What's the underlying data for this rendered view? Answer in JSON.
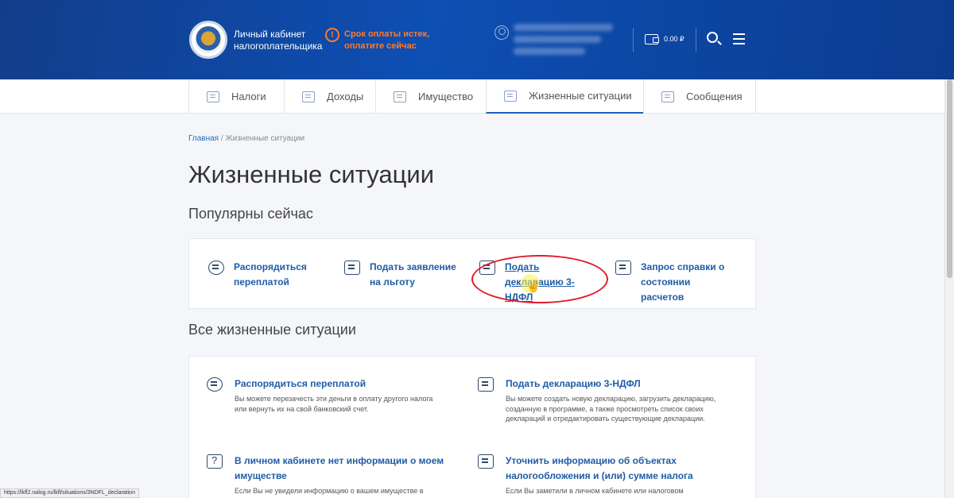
{
  "header": {
    "title": "Личный кабинет налогоплательщика",
    "warning": "Срок оплаты истек, оплатите сейчас",
    "balance": "0.00 ₽"
  },
  "nav": {
    "tabs": [
      {
        "label": "Налоги",
        "icon": "tax-icon"
      },
      {
        "label": "Доходы",
        "icon": "income-icon"
      },
      {
        "label": "Имущество",
        "icon": "property-icon"
      },
      {
        "label": "Жизненные ситуации",
        "icon": "life-situations-icon",
        "active": true
      },
      {
        "label": "Сообщения",
        "icon": "messages-icon"
      }
    ]
  },
  "breadcrumb": {
    "home": "Главная",
    "separator": " / ",
    "current": "Жизненные ситуации"
  },
  "page": {
    "title": "Жизненные ситуации",
    "popular_title": "Популярны сейчас",
    "all_title": "Все жизненные ситуации"
  },
  "popular": [
    {
      "label": "Распорядиться переплатой",
      "icon": "overpayment-icon"
    },
    {
      "label": "Подать заявление на льготу",
      "icon": "benefit-icon"
    },
    {
      "label": "Подать декларацию 3-НДФЛ",
      "icon": "declaration-icon"
    },
    {
      "label": "Запрос справки о состоянии расчетов",
      "icon": "certificate-icon"
    }
  ],
  "all": [
    {
      "title": "Распорядиться переплатой",
      "desc": "Вы можете перезачесть эти деньги в оплату другого налога или вернуть их на свой банковский счет.",
      "icon": "overpayment-icon"
    },
    {
      "title": "Подать декларацию 3-НДФЛ",
      "desc": "Вы можете создать новую декларацию, загрузить декларацию, созданную в программе, а также просмотреть список своих деклараций и отредактировать существующие декларации.",
      "icon": "declaration-icon"
    },
    {
      "title": "В личном кабинете нет информации о моем имуществе",
      "desc": "Если Вы не увидели информацию о вашем имуществе в",
      "icon": "question-icon"
    },
    {
      "title": "Уточнить информацию об объектах налогообложения и (или) сумме налога",
      "desc": "Если Вы заметили в личном кабинете или налоговом",
      "icon": "clarify-icon"
    }
  ],
  "status_url": "https://lkfl2.nalog.ru/lkfl/situations/3NDFL_declaration",
  "colors": {
    "header": "#0d4fb3",
    "link": "#1f5ca6",
    "warning": "#ff7a2e",
    "highlight": "#e01c2a"
  }
}
